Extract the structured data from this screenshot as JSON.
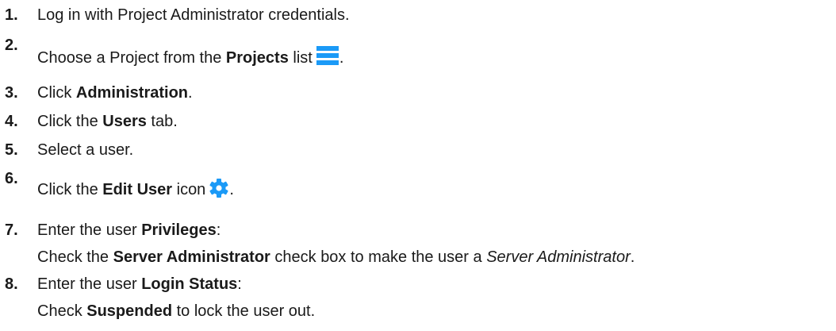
{
  "steps": [
    {
      "num": "1.",
      "a": "Log in with Project Administrator credentials."
    },
    {
      "num": "2.",
      "a": "Choose a Project from the ",
      "b": "Projects",
      "c": " list",
      "d": "."
    },
    {
      "num": "3.",
      "a": "Click ",
      "b": "Administration",
      "c": "."
    },
    {
      "num": "4.",
      "a": "Click the ",
      "b": "Users",
      "c": " tab."
    },
    {
      "num": "5.",
      "a": "Select a user."
    },
    {
      "num": "6.",
      "a": "Click the ",
      "b": "Edit User",
      "c": " icon",
      "d": "."
    },
    {
      "num": "7.",
      "a": "Enter the user ",
      "b": "Privileges",
      "c": ":",
      "sub": {
        "a": "Check the ",
        "b": "Server Administrator",
        "c": " check box to make the user a ",
        "d": "Server Administrator",
        "e": "."
      }
    },
    {
      "num": "8.",
      "a": "Enter the user ",
      "b": "Login Status",
      "c": ":",
      "sub": {
        "a": "Check ",
        "b": "Suspended",
        "c": " to lock the user out."
      }
    }
  ],
  "icons": {
    "projects_list": "list-menu-icon",
    "edit_user": "gear-icon"
  },
  "colors": {
    "icon_blue": "#1b9af7",
    "text": "#1a1a1a"
  }
}
